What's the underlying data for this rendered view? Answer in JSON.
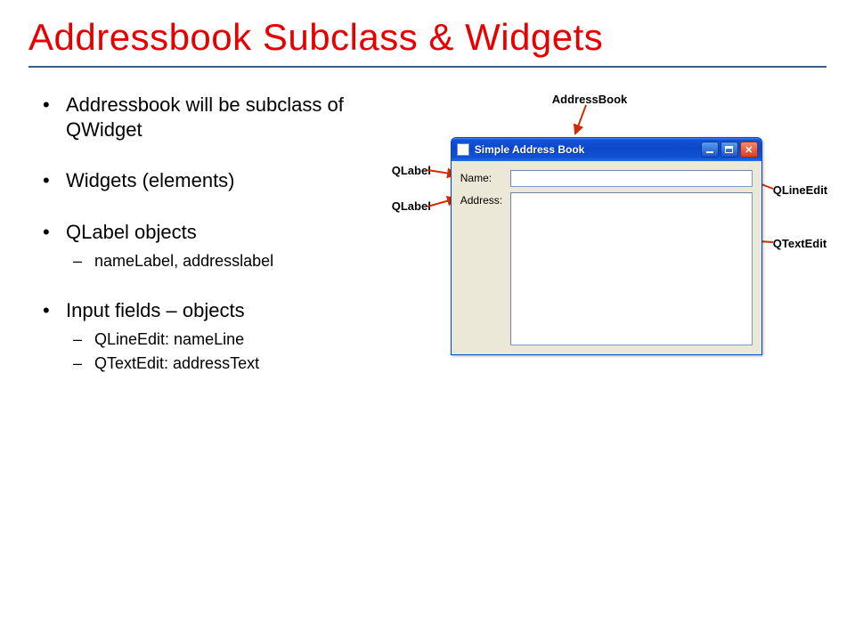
{
  "slide": {
    "title": "Addressbook Subclass & Widgets",
    "bullets": [
      {
        "text": "Addressbook will be subclass of QWidget",
        "sub": []
      },
      {
        "text": "Widgets (elements)",
        "sub": []
      },
      {
        "text": "QLabel objects",
        "sub": [
          "nameLabel, addresslabel"
        ]
      },
      {
        "text": "Input fields – objects",
        "sub": [
          "QLineEdit: nameLine",
          "QTextEdit: addressText"
        ]
      }
    ]
  },
  "diagram": {
    "callouts": {
      "addressbook": "AddressBook",
      "qlabel1": "QLabel",
      "qlabel2": "QLabel",
      "qlineedit": "QLineEdit",
      "qtextedit": "QTextEdit"
    },
    "window": {
      "title": "Simple Address Book",
      "labels": {
        "name": "Name:",
        "address": "Address:"
      }
    }
  }
}
